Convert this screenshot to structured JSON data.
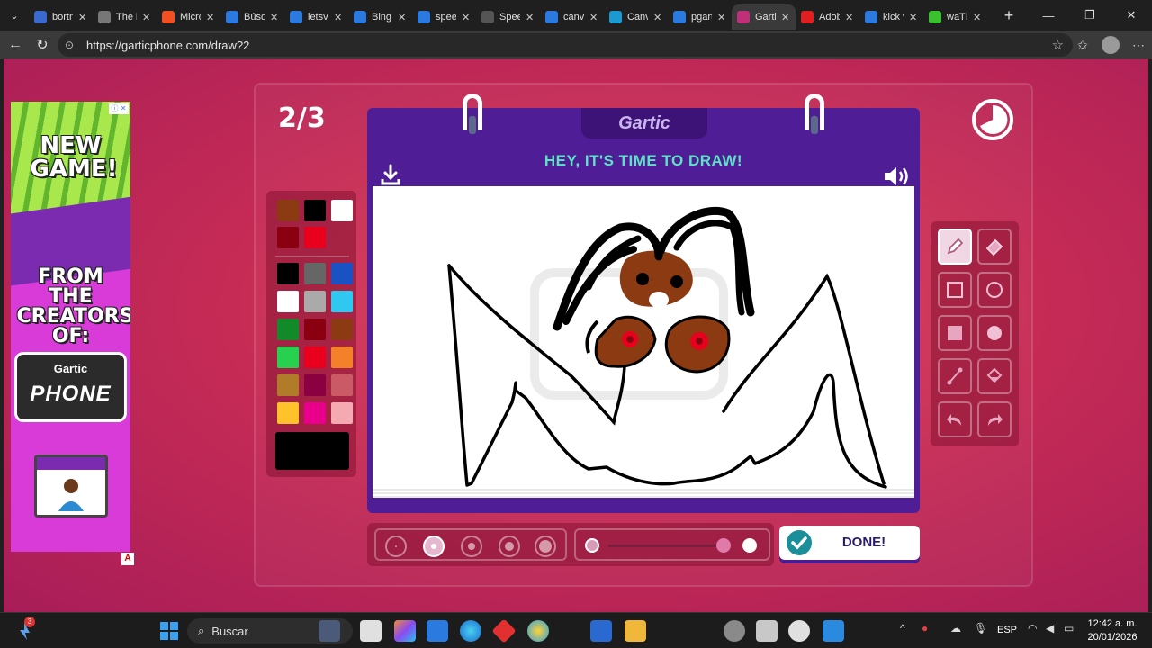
{
  "browser": {
    "tabs": [
      {
        "label": "bortn"
      },
      {
        "label": "The b"
      },
      {
        "label": "Micro"
      },
      {
        "label": "Búsqu"
      },
      {
        "label": "letsvi"
      },
      {
        "label": "Bing"
      },
      {
        "label": "speec"
      },
      {
        "label": "Speec"
      },
      {
        "label": "canva"
      },
      {
        "label": "Canva"
      },
      {
        "label": "pgart"
      },
      {
        "label": "Gartic",
        "active": true
      },
      {
        "label": "Adob"
      },
      {
        "label": "kick v"
      },
      {
        "label": "waTI"
      }
    ],
    "url": "https://garticphone.com/draw?2"
  },
  "ad": {
    "headline": "NEW GAME!",
    "subline": "FROM THE CREATORS OF:",
    "logo_small": "Gartic",
    "logo_big": "PHONE",
    "badge": "ⓘ ✕",
    "footer": "A"
  },
  "game": {
    "round": "2/3",
    "logo": "Gartic",
    "instruction": "HEY, IT'S TIME TO DRAW!",
    "done_label": "DONE!",
    "selected_tool": "pencil",
    "current_color": "#000000",
    "brush_size_selected_index": 1,
    "opacity": 1.0
  },
  "palette": {
    "top": [
      "#8b3a12",
      "#000000",
      "#ffffff",
      "#8b0010",
      "#e8001c"
    ],
    "grid": [
      "#000000",
      "#666666",
      "#1a52c4",
      "#ffffff",
      "#aaaaaa",
      "#2ec8f0",
      "#128a2a",
      "#8b0010",
      "#8b3a12",
      "#28d050",
      "#e8001c",
      "#f5802a",
      "#b07c2a",
      "#8b0040",
      "#c95a66",
      "#ffc22a",
      "#e8008a",
      "#f4aab0"
    ]
  },
  "taskbar": {
    "search_placeholder": "Buscar",
    "notification_count": "3",
    "language": "ESP",
    "time": "12:42 a. m.",
    "date": "20/01/2026"
  }
}
